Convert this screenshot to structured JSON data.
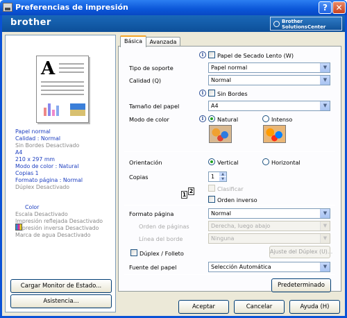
{
  "window": {
    "title": "Preferencias de impresión",
    "help_label": "?",
    "close_label": "✕"
  },
  "brand": {
    "logo": "brother",
    "solutions_center": "Brother\nSolutionsCenter"
  },
  "summary": [
    {
      "text": "Papel normal",
      "style": "blue"
    },
    {
      "text": "Calidad  : Normal",
      "style": "blue"
    },
    {
      "text": "Sin Bordes Desactivado",
      "style": "gray"
    },
    {
      "text": "A4",
      "style": "blue"
    },
    {
      "text": "210 x 297 mm",
      "style": "blue"
    },
    {
      "text": "Modo de color : Natural",
      "style": "blue"
    },
    {
      "text": "Copias 1",
      "style": "blue"
    },
    {
      "text": "Formato página : Normal",
      "style": "blue"
    },
    {
      "text": "Dúplex Desactivado",
      "style": "gray"
    }
  ],
  "summary2": [
    {
      "text": "Color",
      "style": "blue"
    },
    {
      "text": "Escala Desactivado",
      "style": "gray"
    },
    {
      "text": "Impresión reflejada Desactivado",
      "style": "gray"
    },
    {
      "text": "Impresión inversa Desactivado",
      "style": "gray"
    },
    {
      "text": "Marca de agua Desactivado",
      "style": "gray"
    }
  ],
  "left_buttons": {
    "status_monitor": "Cargar Monitor de Estado...",
    "support": "Asistencia..."
  },
  "tabs": [
    {
      "label": "Básica",
      "active": true
    },
    {
      "label": "Avanzada",
      "active": false
    }
  ],
  "basic": {
    "slow_dry_label": "Papel de Secado Lento (W)",
    "media_type_label": "Tipo de soporte",
    "media_type_value": "Papel normal",
    "quality_label": "Calidad (Q)",
    "quality_value": "Normal",
    "borderless_label": "Sin Bordes",
    "paper_size_label": "Tamaño del papel",
    "paper_size_value": "A4",
    "color_mode_label": "Modo de color",
    "color_natural_label": "Natural",
    "color_intense_label": "Intenso",
    "orientation_label": "Orientación",
    "portrait_label": "Vertical",
    "landscape_label": "Horizontal",
    "copies_label": "Copias",
    "copies_value": "1",
    "collate_label": "Clasificar",
    "reverse_order_label": "Orden inverso",
    "page_layout_label": "Formato página",
    "page_layout_value": "Normal",
    "page_order_label": "Orden de páginas",
    "page_order_value": "Derecha, luego abajo",
    "border_line_label": "Línea del borde",
    "border_line_value": "Ninguna",
    "duplex_label": "Dúplex / Folleto",
    "duplex_settings_label": "Ajuste del Dúplex (U)...",
    "paper_source_label": "Fuente del papel",
    "paper_source_value": "Selección Automática",
    "default_button": "Predeterminado"
  },
  "footer": {
    "ok": "Aceptar",
    "cancel": "Cancelar",
    "help": "Ayuda (H)"
  },
  "collate_icon": {
    "page1": "1",
    "page2": "2"
  },
  "colors": {
    "accent": "#0a52d6",
    "summary_blue": "#1a3cbf",
    "summary_gray": "#888888"
  }
}
